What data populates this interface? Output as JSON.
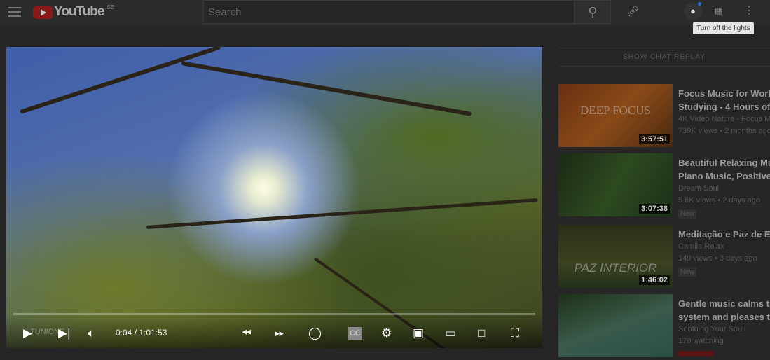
{
  "header": {
    "logo": "YouTube",
    "region": "SE",
    "search_placeholder": "Search",
    "tooltip": "Turn off the lights"
  },
  "chat": {
    "label": "SHOW CHAT REPLAY"
  },
  "player": {
    "time": "0:04 / 1:01:53",
    "progress": 0.001,
    "watermark": "TUNIONE"
  },
  "related": [
    {
      "title1": "Focus Music for Work",
      "title2": "Studying - 4 Hours of",
      "channel": "4K Video Nature - Focus M",
      "stats": "739K views • 2 months ago",
      "duration": "3:57:51",
      "overlay": "DEEP FOCUS"
    },
    {
      "title1": "Beautiful Relaxing Mu",
      "title2": "Piano Music, Positive",
      "channel": "Dream Soul",
      "stats": "5.6K views • 2 days ago",
      "badge": "New",
      "duration": "3:07:38"
    },
    {
      "title1": "Meditação e Paz de E",
      "channel": "Camila Relax",
      "stats": "149 views • 3 days ago",
      "badge": "New",
      "duration": "1:46:02",
      "overlay": "PAZ INTERIOR"
    },
    {
      "title1": "Gentle music calms th",
      "title2": "system and pleases th",
      "channel": "Soothing Your Soul",
      "stats": "170 watching"
    }
  ]
}
